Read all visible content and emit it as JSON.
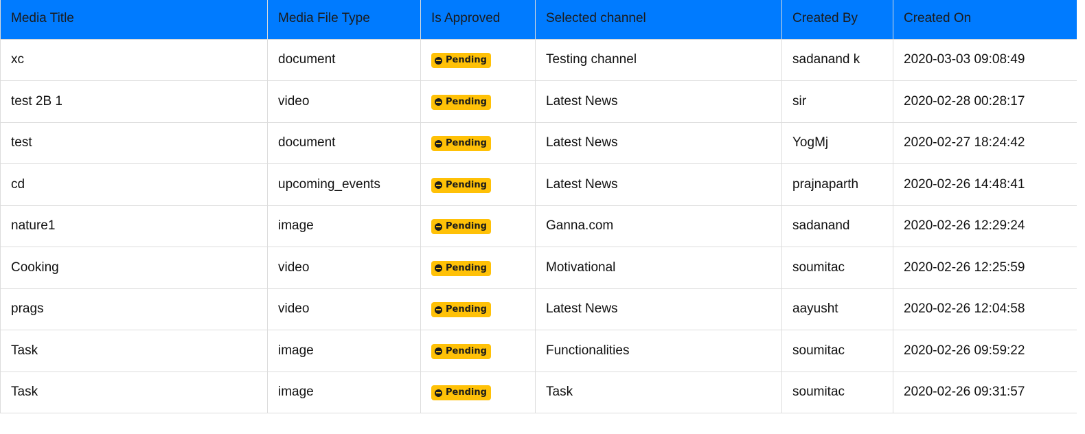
{
  "columns": [
    "Media Title",
    "Media File Type",
    "Is Approved",
    "Selected channel",
    "Created By",
    "Created On"
  ],
  "rows": [
    {
      "title": "xc",
      "type": "document",
      "status": "Pending",
      "channel": "Testing channel",
      "created_by": "sadanand k",
      "created_on": "2020-03-03 09:08:49"
    },
    {
      "title": "test 2B 1",
      "type": "video",
      "status": "Pending",
      "channel": "Latest News",
      "created_by": "sir",
      "created_on": "2020-02-28 00:28:17"
    },
    {
      "title": "test",
      "type": "document",
      "status": "Pending",
      "channel": "Latest News",
      "created_by": "YogMj",
      "created_on": "2020-02-27 18:24:42"
    },
    {
      "title": "cd",
      "type": "upcoming_events",
      "status": "Pending",
      "channel": "Latest News",
      "created_by": "prajnaparth",
      "created_on": "2020-02-26 14:48:41"
    },
    {
      "title": "nature1",
      "type": "image",
      "status": "Pending",
      "channel": "Ganna.com",
      "created_by": "sadanand",
      "created_on": "2020-02-26 12:29:24"
    },
    {
      "title": "Cooking",
      "type": "video",
      "status": "Pending",
      "channel": "Motivational",
      "created_by": "soumitac",
      "created_on": "2020-02-26 12:25:59"
    },
    {
      "title": "prags",
      "type": "video",
      "status": "Pending",
      "channel": "Latest News",
      "created_by": "aayusht",
      "created_on": "2020-02-26 12:04:58"
    },
    {
      "title": "Task",
      "type": "image",
      "status": "Pending",
      "channel": "Functionalities",
      "created_by": "soumitac",
      "created_on": "2020-02-26 09:59:22"
    },
    {
      "title": "Task",
      "type": "image",
      "status": "Pending",
      "channel": "Task",
      "created_by": "soumitac",
      "created_on": "2020-02-26 09:31:57"
    }
  ],
  "colors": {
    "header_bg": "#007bff",
    "badge_bg": "#ffc107"
  },
  "icons": {
    "status": "minus-circle-icon"
  }
}
